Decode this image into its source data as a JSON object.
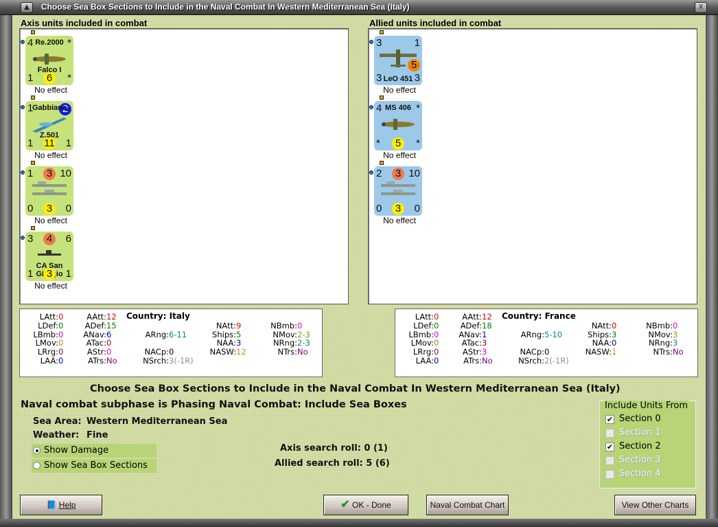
{
  "window": {
    "title": "Choose Sea Box Sections to Include in the Naval Combat In Western Mediterranean Sea (Italy)"
  },
  "axis": {
    "header": "Axis units included in combat",
    "units": [
      {
        "tl": "4",
        "name_top": "Re.2000",
        "tr": "*",
        "name_bottom": "Falco I",
        "bl": "1",
        "bm": "6",
        "br": "*",
        "effect": "No effect",
        "image": "fighter-plane-icon"
      },
      {
        "tl": "1",
        "name_top": "Gabbiano",
        "tr": "2",
        "name_bottom": "Z.501",
        "bl": "1",
        "bm": "11",
        "br": "1",
        "effect": "No effect",
        "image": "seaplane-icon"
      },
      {
        "tl": "1",
        "tm": "3",
        "tr": "10",
        "bl": "0",
        "bm": "3",
        "br": "0",
        "effect": "No effect",
        "image": "transport-ships-icon"
      },
      {
        "tl": "3",
        "tm": "4",
        "tr": "6",
        "name_bottom": "CA San Giorgio",
        "bl": "1",
        "bm": "3",
        "br": "1",
        "effect": "No effect",
        "image": "cruiser-icon"
      }
    ]
  },
  "allied": {
    "header": "Allied units included in combat",
    "units": [
      {
        "tl": "3",
        "tr": "1",
        "mid": "5",
        "bl": "3",
        "name_bottom": "LeO 451",
        "br": "3",
        "effect": "No effect",
        "image": "bomber-plane-icon"
      },
      {
        "tl": "4",
        "name_top": "MS 406",
        "tr": "*",
        "bl": "*",
        "bm": "5",
        "br": "*",
        "effect": "No effect",
        "image": "fighter-plane-icon"
      },
      {
        "tl": "2",
        "tm": "3",
        "tr": "10",
        "bl": "0",
        "bm": "3",
        "br": "0",
        "effect": "No effect",
        "image": "transport-ships-icon"
      }
    ]
  },
  "stats": {
    "axis": {
      "country": "Country: Italy",
      "items": {
        "LAtt": [
          "0",
          "#e00000"
        ],
        "AAtt": [
          "12",
          "#e00000"
        ],
        "LDef": [
          "0",
          "#008000"
        ],
        "ADef": [
          "15",
          "#008000"
        ],
        "NAtt": [
          "9",
          "#e00000"
        ],
        "NBmb": [
          "0",
          "#e000e0"
        ],
        "LBmb": [
          "0",
          "#e000e0"
        ],
        "ANav": [
          "6",
          "#0000c0"
        ],
        "ARng": [
          "6-11",
          "#008888"
        ],
        "Ships": [
          "5",
          "#008000"
        ],
        "NMov": [
          "2-3",
          "#a09000"
        ],
        "LMov": [
          "0",
          "#a09000"
        ],
        "ATac": [
          "0",
          "#a00000"
        ],
        "NAA": [
          "3",
          "#0000c0"
        ],
        "NRng": [
          "2-3",
          "#008888"
        ],
        "LRrg": [
          "0",
          "#800080"
        ],
        "AStr": [
          "0",
          "#e000e0"
        ],
        "NACp": [
          "0",
          "#000000"
        ],
        "NASW": [
          "12",
          "#e08020"
        ],
        "NTrs": [
          "No",
          "#800080"
        ],
        "LAA": [
          "0",
          "#0000c0"
        ],
        "ATrs": [
          "No",
          "#800080"
        ],
        "NSrch": [
          "3(-1R)",
          "#909090"
        ]
      }
    },
    "allied": {
      "country": "Country: France",
      "items": {
        "LAtt": [
          "0",
          "#e00000"
        ],
        "AAtt": [
          "12",
          "#e00000"
        ],
        "LDef": [
          "0",
          "#008000"
        ],
        "ADef": [
          "18",
          "#008000"
        ],
        "NAtt": [
          "0",
          "#e00000"
        ],
        "NBmb": [
          "0",
          "#e000e0"
        ],
        "LBmb": [
          "0",
          "#e000e0"
        ],
        "ANav": [
          "1",
          "#0000c0"
        ],
        "ARng": [
          "5-10",
          "#008888"
        ],
        "Ships": [
          "3",
          "#008000"
        ],
        "NMov": [
          "3",
          "#a09000"
        ],
        "LMov": [
          "0",
          "#a09000"
        ],
        "ATac": [
          "3",
          "#a00000"
        ],
        "NAA": [
          "0",
          "#0000c0"
        ],
        "NRng": [
          "3",
          "#008888"
        ],
        "LRrg": [
          "0",
          "#800080"
        ],
        "AStr": [
          "3",
          "#e000e0"
        ],
        "NACp": [
          "0",
          "#000000"
        ],
        "NASW": [
          "1",
          "#e08020"
        ],
        "NTrs": [
          "No",
          "#800080"
        ],
        "LAA": [
          "0",
          "#0000c0"
        ],
        "ATrs": [
          "No",
          "#800080"
        ],
        "NSrch": [
          "2(-1R)",
          "#909090"
        ]
      }
    }
  },
  "main": {
    "heading": "Choose Sea Box Sections to Include in the Naval Combat In Western Mediterranean Sea (Italy)",
    "subphase": "Naval combat subphase is Phasing Naval Combat: Include Sea Boxes",
    "sea_area_label": "Sea Area:",
    "sea_area": "Western Mediterranean Sea",
    "weather_label": "Weather:",
    "weather": "Fine",
    "axis_roll": "Axis search roll: 0 (1)",
    "allied_roll": "Allied search roll: 5 (6)",
    "radios": [
      {
        "label": "Show Damage",
        "selected": true
      },
      {
        "label": "Show Sea Box Sections",
        "selected": false
      }
    ]
  },
  "include": {
    "legend": "Include Units From",
    "sections": [
      {
        "label": "Section 0",
        "checked": true,
        "enabled": true
      },
      {
        "label": "Section 1",
        "checked": false,
        "enabled": false
      },
      {
        "label": "Section 2",
        "checked": true,
        "enabled": true
      },
      {
        "label": "Section 3",
        "checked": false,
        "enabled": false
      },
      {
        "label": "Section 4",
        "checked": false,
        "enabled": false
      }
    ]
  },
  "buttons": {
    "help": "Help",
    "ok": "OK - Done",
    "naval_chart": "Naval Combat Chart",
    "other_charts": "View Other Charts"
  }
}
